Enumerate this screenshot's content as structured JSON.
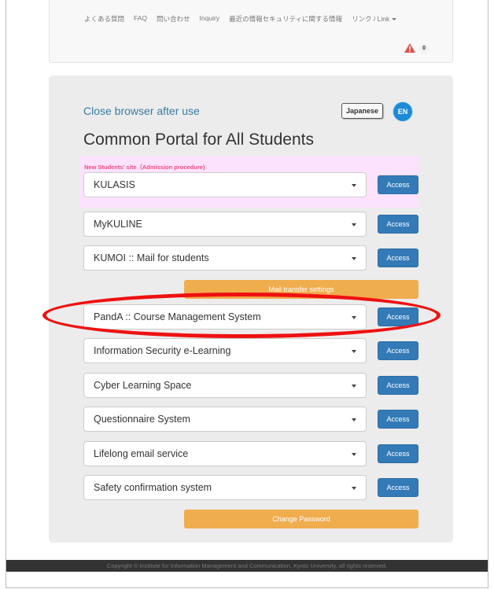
{
  "nav": {
    "links": [
      "よくある質問",
      "FAQ",
      "問い合わせ",
      "Inquiry",
      "最近の情報セキュリティに関する情報",
      "リンク / Link"
    ],
    "alert_count": "0"
  },
  "panel": {
    "close_msg": "Close browser after use",
    "lang_japanese": "Japanese",
    "lang_en": "EN",
    "title": "Common Portal for All Students",
    "new_students_label": "New Students' site（Admission procedure)",
    "access_label": "Access",
    "services": [
      "KULASIS",
      "MyKULINE",
      "KUMOI :: Mail for students",
      "PandA :: Course Management System",
      "Information Security e-Learning",
      "Cyber Learning Space",
      "Questionnaire System",
      "Lifelong email service",
      "Safety confirmation system"
    ],
    "mail_transfer_label": "Mail transfer settings",
    "change_password_label": "Change Password"
  },
  "footer": {
    "copyright": "Copyright © Institute for Information Management and Communication, Kyoto University, all rights reserved."
  },
  "colors": {
    "access_blue": "#337ab7",
    "orange": "#f0ad4e",
    "highlight_pink": "#fde2fd",
    "annotation_red": "#ee1111"
  }
}
